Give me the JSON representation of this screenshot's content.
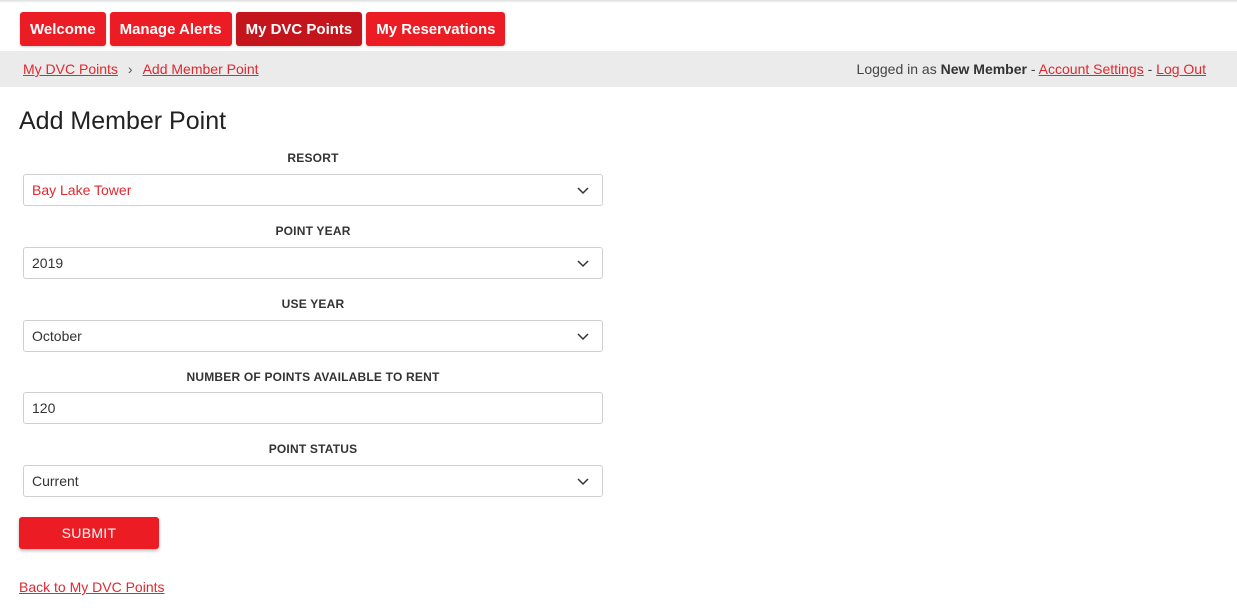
{
  "nav": {
    "tabs": [
      {
        "label": "Welcome",
        "active": false
      },
      {
        "label": "Manage Alerts",
        "active": false
      },
      {
        "label": "My DVC Points",
        "active": true
      },
      {
        "label": "My Reservations",
        "active": false
      }
    ]
  },
  "breadcrumb": {
    "items": [
      "My DVC Points",
      "Add Member Point"
    ],
    "separator": "›"
  },
  "user": {
    "prefix": "Logged in as",
    "name": "New Member",
    "dash1": "-",
    "account_settings": "Account Settings",
    "dash2": "-",
    "logout": "Log Out"
  },
  "page": {
    "title": "Add Member Point"
  },
  "form": {
    "resort": {
      "label": "RESORT",
      "value": "Bay Lake Tower"
    },
    "point_year": {
      "label": "POINT YEAR",
      "value": "2019"
    },
    "use_year": {
      "label": "USE YEAR",
      "value": "October"
    },
    "points_available": {
      "label": "NUMBER OF POINTS AVAILABLE TO RENT",
      "value": "120"
    },
    "point_status": {
      "label": "POINT STATUS",
      "value": "Current"
    },
    "submit_label": "SUBMIT"
  },
  "footer": {
    "back_link": "Back to My DVC Points"
  },
  "colors": {
    "accent": "#ec1c24",
    "accent_active": "#c4151c",
    "link": "#e0282f",
    "crumb_bar": "#ebebeb"
  }
}
